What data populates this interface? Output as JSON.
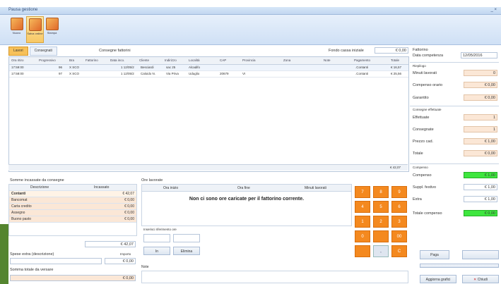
{
  "window": {
    "title": "Pausa gestione",
    "controls": "_ ×"
  },
  "ribbon": {
    "buttons": [
      {
        "label": "Nuovo",
        "icon": "new-icon"
      },
      {
        "label": "Salva ordine",
        "icon": "save-icon"
      },
      {
        "label": "Stampa",
        "icon": "print-icon"
      }
    ]
  },
  "tabs": [
    "Lavori",
    "Consegnati"
  ],
  "filters": {
    "consegne_label": "Consegne fattorini",
    "fondo_label": "Fondo cassa iniziale",
    "fondo_value": "€ 0,00"
  },
  "grid": {
    "headers": [
      "Ora ritiro",
      "Progressivo",
      "Bra",
      "Fattorino",
      "Data inco.",
      "Cliente",
      "Indirizzo",
      "Località",
      "CAP",
      "Provincia",
      "Zona",
      "Note",
      "Pagamento",
      "Totale"
    ],
    "rows": [
      [
        "17:59:00",
        "96",
        "X SCO",
        "",
        "1 12/05/2",
        "Besciardi",
        "sac 25",
        "Alcadifo",
        "",
        "",
        "",
        "",
        ".Contanti",
        "€ 16,57"
      ],
      [
        "17:58:00",
        "97",
        "X SCO",
        "",
        "1 12/05/2",
        "Caloido N.",
        "Via Priva",
        "Uduglio",
        "20679",
        "VI",
        "",
        "",
        ".Contanti",
        "€ 25,56"
      ]
    ],
    "footer_total": "€ 42,07"
  },
  "right": {
    "title": "Fattorino",
    "data_label": "Data competenza",
    "data_value": "12/05/2016",
    "section1": "Riepilogo",
    "fields1": [
      {
        "label": "Minuti lavorati",
        "value": "0"
      },
      {
        "label": "Compenso orario",
        "value": "€ 0,00"
      },
      {
        "label": "Garantito",
        "value": "€ 0,00"
      }
    ],
    "section2": "Consegne effettuate",
    "fields2": [
      {
        "label": "Effettuate",
        "value": "1"
      },
      {
        "label": "Consegnate",
        "value": "1"
      },
      {
        "label": "Prezzo cad.",
        "value": "€ 1,00"
      },
      {
        "label": "Totale",
        "value": "€ 0,00"
      }
    ],
    "section3": "Compenso",
    "fields3": [
      {
        "label": "Compenso",
        "value": "€ 1,00",
        "green": true
      },
      {
        "label": "Suppl. festivo",
        "value": "€ 1,00"
      },
      {
        "label": "Extra",
        "value": "€ 1,00"
      },
      {
        "label": "Totale compenso",
        "value": "€ 0,00",
        "green": true
      }
    ],
    "buttons": [
      "Paga",
      "Aggiorna grafici",
      "Chiudi"
    ]
  },
  "incasso": {
    "title": "Somme incassate da consegne",
    "headers": [
      "Descrizione",
      "Incassato"
    ],
    "rows": [
      [
        "Contanti",
        "€ 42,07"
      ],
      [
        "Bancomat",
        "€ 0,00"
      ],
      [
        "Carta credito",
        "€ 0,00"
      ],
      [
        "Assegno",
        "€ 0,00"
      ],
      [
        "Buono pasto",
        "€ 0,00"
      ]
    ],
    "total": "€ 42,07",
    "spese_label": "Spese extra (descrizione)",
    "importo_label": "Importo",
    "spese_value": "€ 0,00",
    "versare_label": "Somma totale da versare",
    "versare_value": "€ 0,00"
  },
  "ore": {
    "title": "Ore lavorate",
    "headers": [
      "Ora inizio",
      "Ora fine",
      "Minuti lavorati"
    ],
    "empty": "Non ci sono ore caricate per il fattorino corrente.",
    "inserisci_label": "Inserisci riferimento ore",
    "btn_in": "In",
    "btn_out": "Elimina",
    "note_label": "Note"
  },
  "keypad": [
    "7",
    "8",
    "9",
    "4",
    "5",
    "6",
    "1",
    "2",
    "3",
    "0",
    "00",
    ",",
    "C"
  ]
}
